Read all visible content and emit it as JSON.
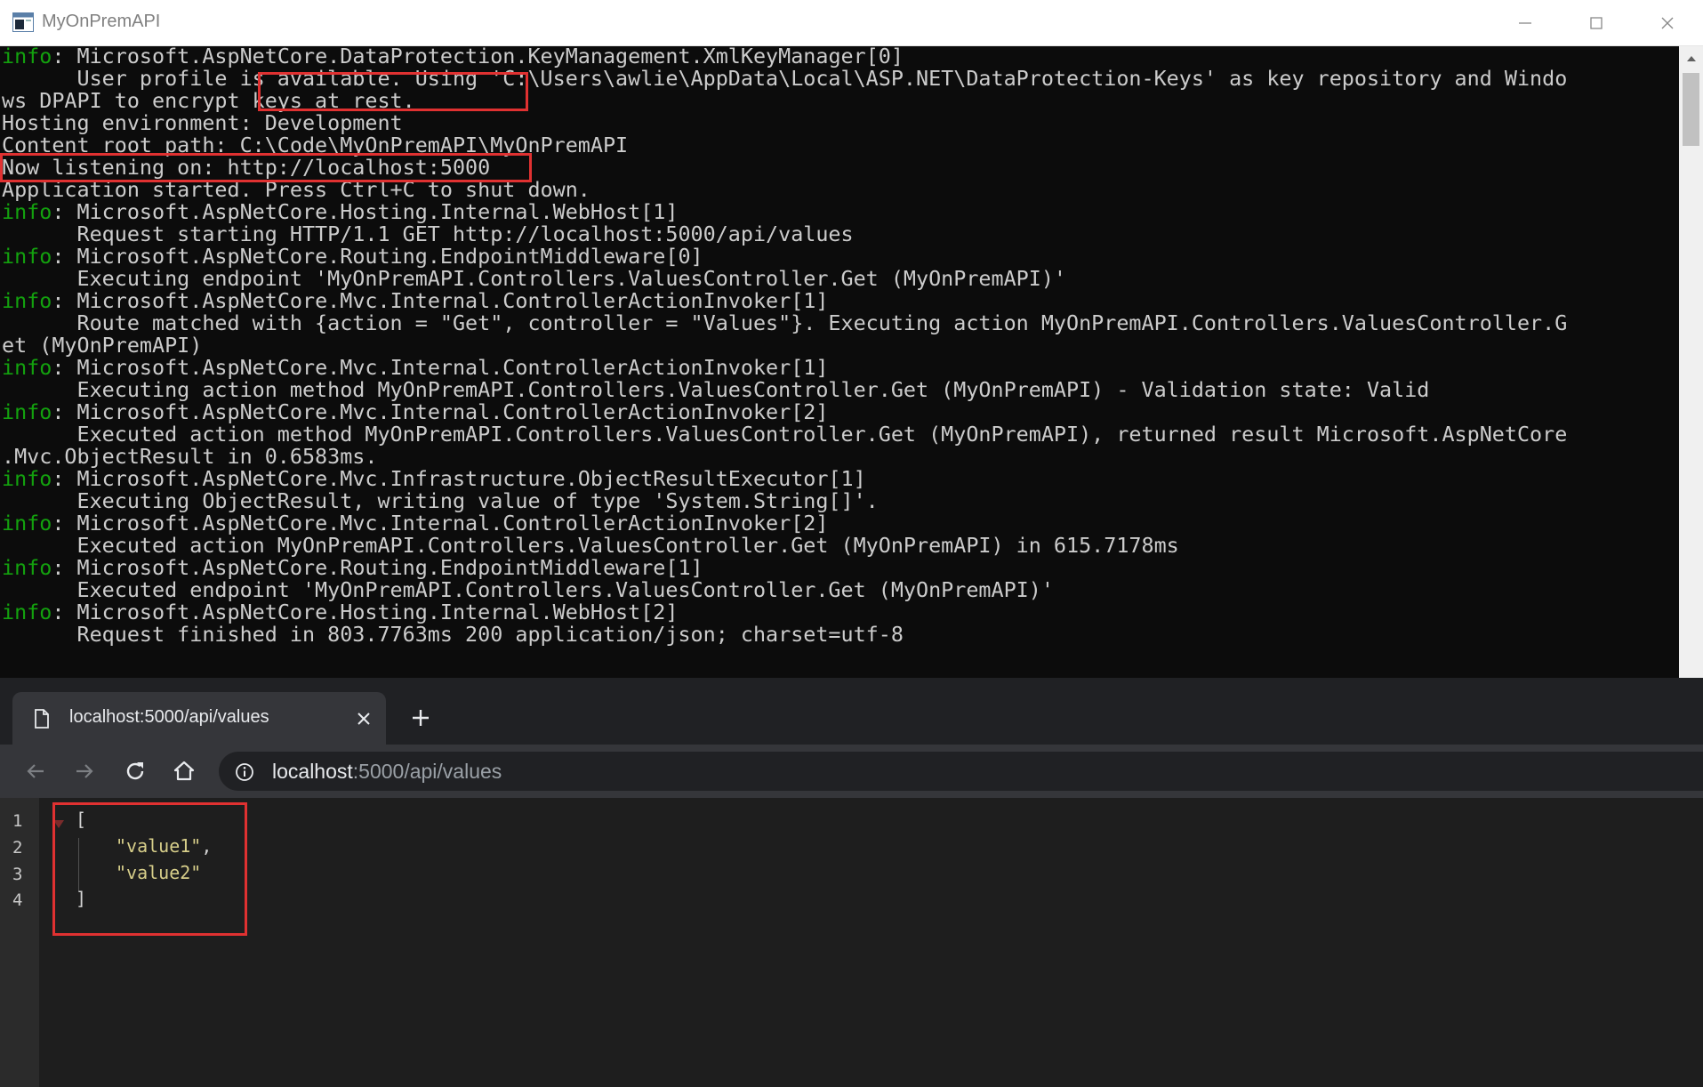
{
  "console": {
    "title": "MyOnPremAPI",
    "lines": [
      [
        {
          "t": "info",
          "c": "info"
        },
        {
          "t": ": Microsoft.AspNetCore.DataProtection.KeyManagement.XmlKeyManager[0]"
        }
      ],
      [
        {
          "t": "      User profile is available. Using 'C:\\Users\\awlie\\AppData\\Local\\ASP.NET\\DataProtection-Keys' as key repository and Windo"
        }
      ],
      [
        {
          "t": "ws DPAPI to encrypt keys at rest."
        }
      ],
      [
        {
          "t": "Hosting environment: Development"
        }
      ],
      [
        {
          "t": "Content root path: C:\\Code\\MyOnPremAPI\\MyOnPremAPI"
        }
      ],
      [
        {
          "t": "Now listening on: http://localhost:5000"
        }
      ],
      [
        {
          "t": "Application started. Press Ctrl+C to shut down."
        }
      ],
      [
        {
          "t": "info",
          "c": "info"
        },
        {
          "t": ": Microsoft.AspNetCore.Hosting.Internal.WebHost[1]"
        }
      ],
      [
        {
          "t": "      Request starting HTTP/1.1 GET http://localhost:5000/api/values"
        }
      ],
      [
        {
          "t": "info",
          "c": "info"
        },
        {
          "t": ": Microsoft.AspNetCore.Routing.EndpointMiddleware[0]"
        }
      ],
      [
        {
          "t": "      Executing endpoint 'MyOnPremAPI.Controllers.ValuesController.Get (MyOnPremAPI)'"
        }
      ],
      [
        {
          "t": "info",
          "c": "info"
        },
        {
          "t": ": Microsoft.AspNetCore.Mvc.Internal.ControllerActionInvoker[1]"
        }
      ],
      [
        {
          "t": "      Route matched with {action = \"Get\", controller = \"Values\"}. Executing action MyOnPremAPI.Controllers.ValuesController.G"
        }
      ],
      [
        {
          "t": "et (MyOnPremAPI)"
        }
      ],
      [
        {
          "t": "info",
          "c": "info"
        },
        {
          "t": ": Microsoft.AspNetCore.Mvc.Internal.ControllerActionInvoker[1]"
        }
      ],
      [
        {
          "t": "      Executing action method MyOnPremAPI.Controllers.ValuesController.Get (MyOnPremAPI) - Validation state: Valid"
        }
      ],
      [
        {
          "t": "info",
          "c": "info"
        },
        {
          "t": ": Microsoft.AspNetCore.Mvc.Internal.ControllerActionInvoker[2]"
        }
      ],
      [
        {
          "t": "      Executed action method MyOnPremAPI.Controllers.ValuesController.Get (MyOnPremAPI), returned result Microsoft.AspNetCore"
        }
      ],
      [
        {
          "t": ".Mvc.ObjectResult in 0.6583ms."
        }
      ],
      [
        {
          "t": "info",
          "c": "info"
        },
        {
          "t": ": Microsoft.AspNetCore.Mvc.Infrastructure.ObjectResultExecutor[1]"
        }
      ],
      [
        {
          "t": "      Executing ObjectResult, writing value of type 'System.String[]'."
        }
      ],
      [
        {
          "t": "info",
          "c": "info"
        },
        {
          "t": ": Microsoft.AspNetCore.Mvc.Internal.ControllerActionInvoker[2]"
        }
      ],
      [
        {
          "t": "      Executed action MyOnPremAPI.Controllers.ValuesController.Get (MyOnPremAPI) in 615.7178ms"
        }
      ],
      [
        {
          "t": "info",
          "c": "info"
        },
        {
          "t": ": Microsoft.AspNetCore.Routing.EndpointMiddleware[1]"
        }
      ],
      [
        {
          "t": "      Executed endpoint 'MyOnPremAPI.Controllers.ValuesController.Get (MyOnPremAPI)'"
        }
      ],
      [
        {
          "t": "info",
          "c": "info"
        },
        {
          "t": ": Microsoft.AspNetCore.Hosting.Internal.WebHost[2]"
        }
      ],
      [
        {
          "t": "      Request finished in 803.7763ms 200 application/json; charset=utf-8"
        }
      ]
    ]
  },
  "browser": {
    "tab_title": "localhost:5000/api/values",
    "url_host": "localhost",
    "url_path": ":5000/api/values",
    "line_numbers": [
      "1",
      "2",
      "3",
      "4"
    ],
    "json": {
      "open": "[",
      "item1": "\"value1\"",
      "comma": ",",
      "item2": "\"value2\"",
      "close": "]"
    }
  },
  "icons": {
    "app": "console-app-icon",
    "minimize": "minimize-icon",
    "maximize": "maximize-icon",
    "close": "close-icon",
    "scroll_up": "scroll-up-arrow-icon",
    "tab_file": "file-icon",
    "tab_close": "tab-close-icon",
    "new_tab": "plus-icon",
    "back": "back-arrow-icon",
    "forward": "forward-arrow-icon",
    "reload": "reload-icon",
    "home": "home-icon",
    "info": "info-icon"
  },
  "colors": {
    "info_green": "#13a10e",
    "highlight_red": "#e03131",
    "json_string": "#d7ce8a"
  }
}
